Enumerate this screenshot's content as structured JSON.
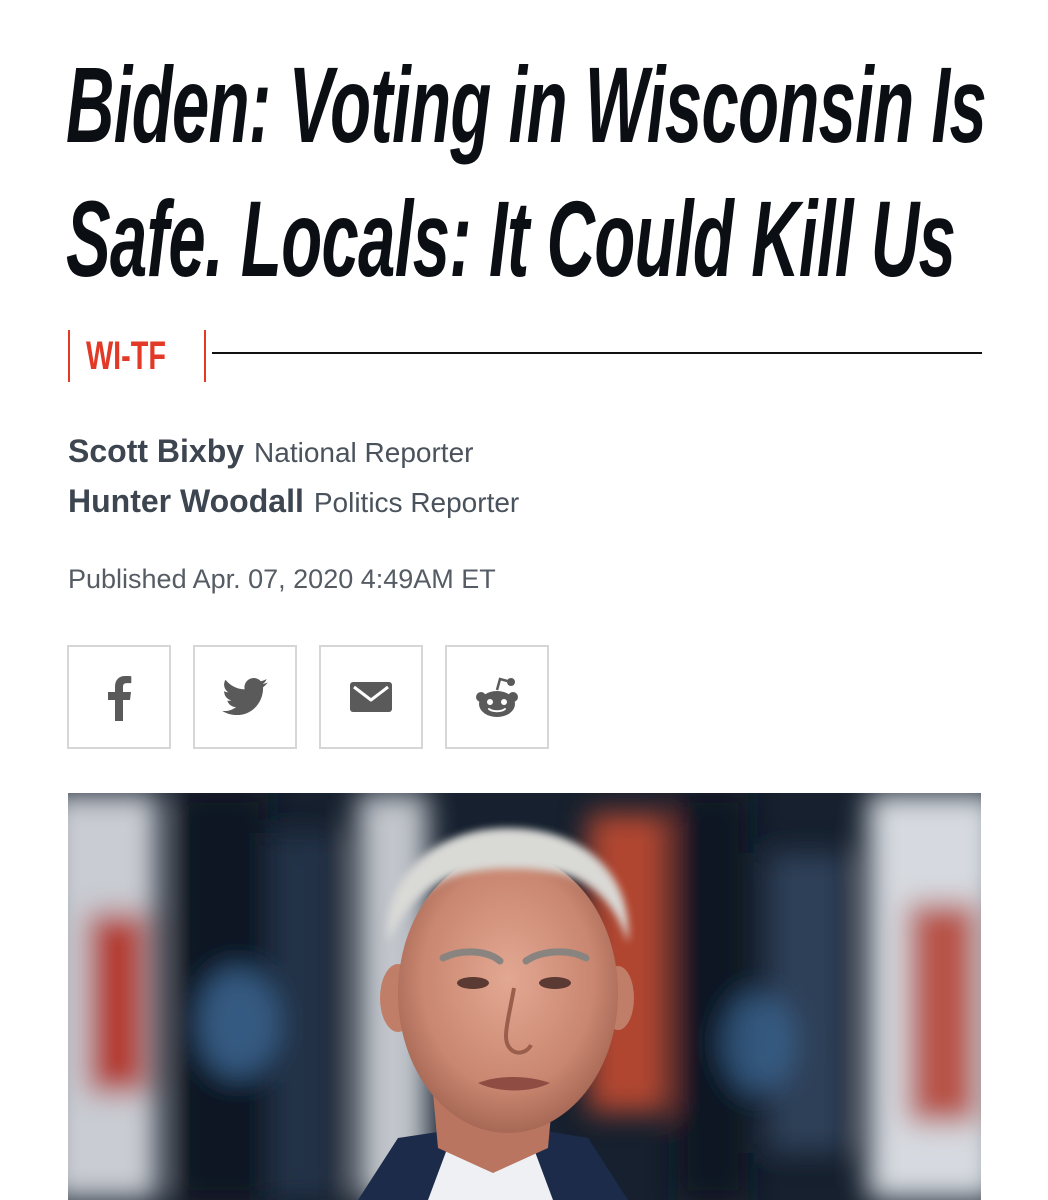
{
  "article": {
    "headline_line1": "Biden: Voting in Wisconsin Is",
    "headline_line2": "Safe. Locals: It Could Kill Us",
    "rubric": "WI-TF",
    "authors": [
      {
        "name": "Scott Bixby",
        "role": "National Reporter"
      },
      {
        "name": "Hunter Woodall",
        "role": "Politics Reporter"
      }
    ],
    "published": "Published Apr. 07, 2020 4:49AM ET"
  },
  "share": [
    {
      "icon": "facebook-icon"
    },
    {
      "icon": "twitter-icon"
    },
    {
      "icon": "email-icon"
    },
    {
      "icon": "reddit-icon"
    }
  ],
  "colors": {
    "accent": "#e23a26",
    "headline": "#0b0f14",
    "byline": "#3d4550",
    "icon": "#5a5a5a",
    "border": "#d6d6d6"
  }
}
